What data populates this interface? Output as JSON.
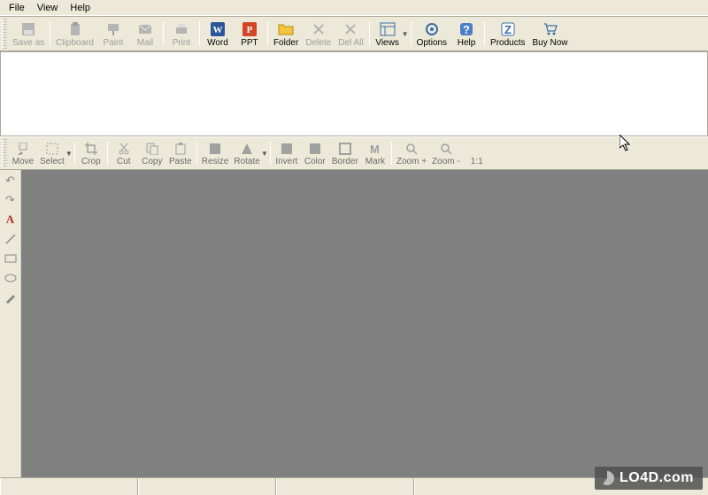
{
  "menu": {
    "file": "File",
    "view": "View",
    "help": "Help"
  },
  "toolbar": {
    "save_as": "Save as",
    "clipboard": "Clipboard",
    "paint": "Paint",
    "mail": "Mail",
    "print": "Print",
    "word": "Word",
    "ppt": "PPT",
    "folder": "Folder",
    "delete": "Delete",
    "del_all": "Del All",
    "views": "Views",
    "options": "Options",
    "help": "Help",
    "products": "Products",
    "buy_now": "Buy Now"
  },
  "editor_toolbar": {
    "move": "Move",
    "select": "Select",
    "crop": "Crop",
    "cut": "Cut",
    "copy": "Copy",
    "paste": "Paste",
    "resize": "Resize",
    "rotate": "Rotate",
    "invert": "Invert",
    "color": "Color",
    "border": "Border",
    "mark": "Mark",
    "zoom_in": "Zoom +",
    "zoom_out": "Zoom -",
    "zoom_fit": "1:1"
  },
  "watermark": "LO4D.com"
}
